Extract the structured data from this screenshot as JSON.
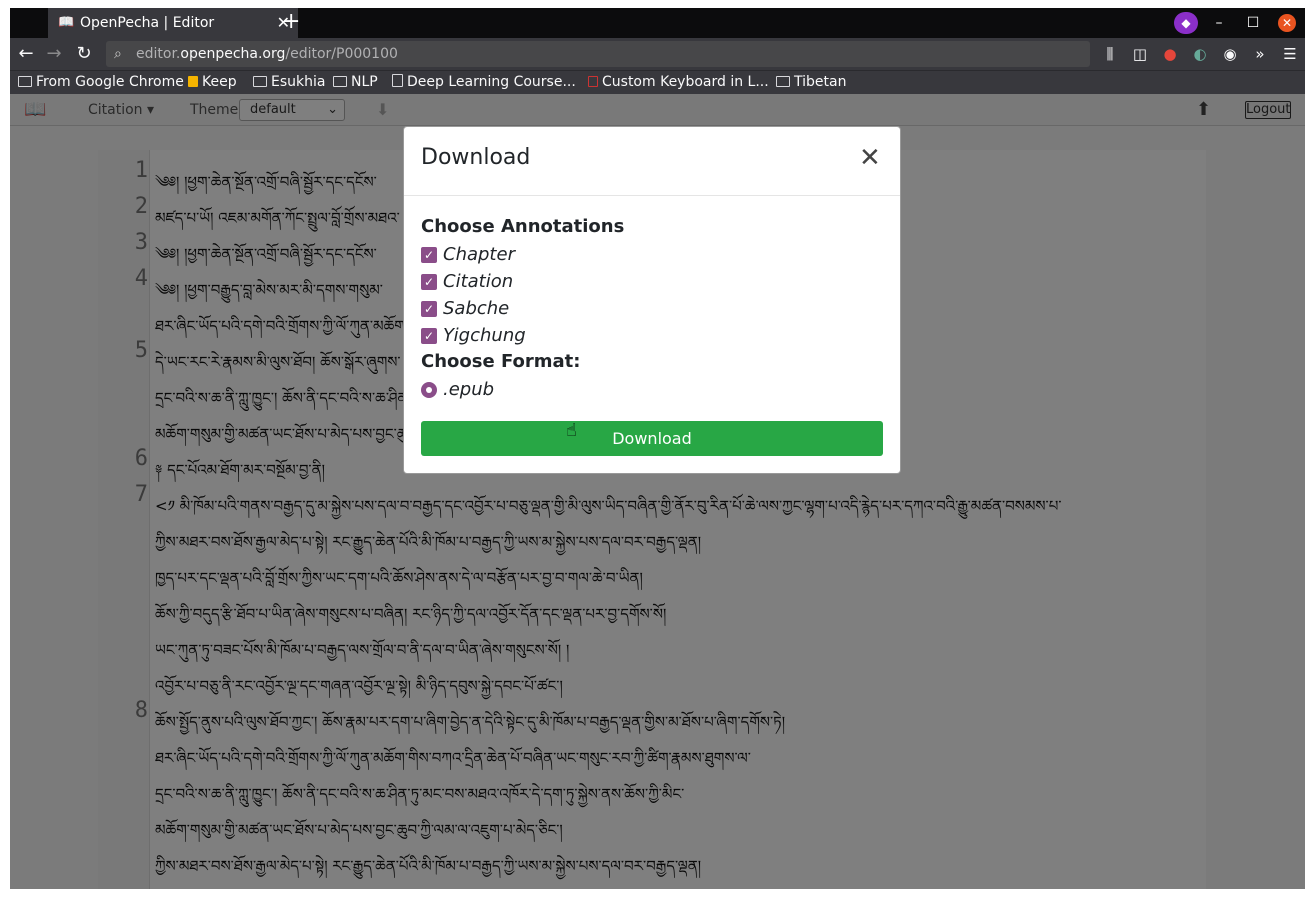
{
  "browser": {
    "tab_title": "OpenPecha | Editor",
    "tab_close": "✕",
    "new_tab": "+",
    "url_prefix": "editor.",
    "url_domain": "openpecha.org",
    "url_path": "/editor/P000100",
    "window_controls": [
      "–",
      "☐",
      "✕"
    ],
    "nav_icons": [
      "back-icon",
      "forward-icon",
      "reload-icon"
    ],
    "right_icons": [
      "library-icon",
      "sidebar-icon",
      "tomato-icon",
      "extension-icon",
      "account-icon",
      "overflow-icon",
      "menu-icon"
    ]
  },
  "bookmarks": [
    {
      "label": "From Google Chrome",
      "icon": "folder-icon"
    },
    {
      "label": "Keep",
      "icon": "keep-icon"
    },
    {
      "label": "Esukhia",
      "icon": "folder-icon"
    },
    {
      "label": "NLP",
      "icon": "folder-icon"
    },
    {
      "label": "Deep Learning Course...",
      "icon": "page-icon"
    },
    {
      "label": "Custom Keyboard in L...",
      "icon": "page-icon"
    },
    {
      "label": "Tibetan",
      "icon": "folder-icon"
    }
  ],
  "toolbar": {
    "citation": "Citation",
    "theme_label": "Theme",
    "theme_value": "default",
    "logout": "Logout"
  },
  "editor": {
    "line_numbers": [
      "1",
      "2",
      "3",
      "4",
      "5",
      "6",
      "7",
      "8"
    ],
    "lines": [
      "༄༅། །ཕྱག་ཆེན་སྔོན་འགྲོ་བཞི་སྦྱོར་དང་དངོས་",
      "མཛད་པ་ཡོ། འཇམ་མགོན་ཀོང་སྤྲུལ་བློ་གྲོས་མཐའ་",
      "༄༅། །ཕྱག་ཆེན་སྔོན་འགྲོ་བཞི་སྦྱོར་དང་དངོས་",
      "༄༅། །ཕྱག་བརྒྱུད་བླ་མེས་མར་མི་དགས་གསུམ་",
      "དེ་ཡང་རང་རེ་རྣམས་མི་ལུས་ཐོབ། ཆོས་སྒོར་ཞུགས་",
      "༈ དང་པོའམ་ཐོག་མར་བསྔོམ་བྱ་ནི།",
      "<༡ མི་ཁོམ་པའི་གནས་བརྒྱད་དུ་མ་སྐྱེས་པས་དལ་བ་བརྒྱད་དང་འབྱོར་པ་བཅུ་ལྡན་གྱི་མི་ལུས་ཡིད་བཞིན་གྱི་ནོར་བུ་རིན་པོ་ཆེ་ལས་ཀྱང་ལྷག་པ་འདི་རྙེད་པར་དཀའ་བའི་རྒྱུ་མཚན་བསམས་པ་",
      "ཆོས་སྤྱོད་ནུས་པའི་ལུས་ཐོབ་ཀྱང་། ཆོས་རྣམ་པར་དག་པ་ཞིག་བྱེད་ན་དེའི་སྟེང་དུ་མི་ཁོམ་པ་བརྒྱད་ལྡན་གྱིས་མ་ཐོས་པ་ཞིག་དགོས་ཏེ།"
    ],
    "extra_lines": [
      "ཐར་ཞིང་ཡོད་པའི་དགེ་བའི་གྲོགས་ཀྱི་ལོ་ཀུན་མཆོག་གིས་བཀའ་དྲིན་ཆེན་པོ་བཞིན་ཡང་གསུང་རབ་ཀྱི་ཚིག་རྣམས་ཐུགས་ལ་",
      "དྲང་བའི་ས་ཆ་ནི་ཀླུ་ཁྱུང་། ཆོས་ནི་དང་བའི་ས་ཆ་ཤིན་ཏུ་མང་བས་མཐའ་འཁོར་དེ་དག་ཏུ་སྐྱེས་ནས་ཆོས་ཀྱི་མིང་",
      "མཆོག་གསུམ་གྱི་མཚན་ཡང་ཐོས་པ་མེད་པས་བྱང་ཆུབ་ཀྱི་ལམ་ལ་འཇུག་པ་མེད་ཅིང་།",
      "ཀྱིས་མཐར་བས་ཐོས་རྒྱལ་མེད་པ་སྟེ། རང་རྒྱུད་ཆེན་པོའི་མི་ཁོམ་པ་བརྒྱད་ཀྱི་ཡས་མ་སྐྱེས་པས་དལ་བར་བརྒྱད་ལྡན།",
      "ཁྱད་པར་དང་ལྡན་པའི་བློ་གྲོས་ཀྱིས་ཡང་དག་པའི་ཆོས་ཤེས་ནས་དེ་ལ་བརྩོན་པར་བྱ་བ་གལ་ཆེ་བ་ཡིན།",
      "ཆོས་ཀྱི་བདུད་རྩི་ཐོབ་པ་ཡིན་ཞེས་གསུངས་པ་བཞིན། རང་ཉིད་ཀྱི་དལ་འབྱོར་དོན་དང་ལྡན་པར་བྱ་དགོས་སོ།",
      "ཡང་ཀུན་ཏུ་བཟང་པོས་མི་ཁོམ་པ་བརྒྱད་ལས་གྲོལ་བ་ནི་དལ་བ་ཡིན་ཞེས་གསུངས་སོ། །",
      "འབྱོར་པ་བཅུ་ནི་རང་འབྱོར་ལྔ་དང་གཞན་འབྱོར་ལྔ་སྟེ། མི་ཉིད་དབུས་སྐྱེ་དབང་པོ་ཚང་།"
    ]
  },
  "modal": {
    "title": "Download",
    "close": "✕",
    "annotations_heading": "Choose Annotations",
    "annotations": [
      "Chapter",
      "Citation",
      "Sabche",
      "Yigchung"
    ],
    "format_heading": "Choose Format:",
    "formats": [
      ".epub"
    ],
    "download_button": "Download"
  },
  "colors": {
    "accent_purple": "#8a4d89",
    "download_green": "#28a745"
  }
}
